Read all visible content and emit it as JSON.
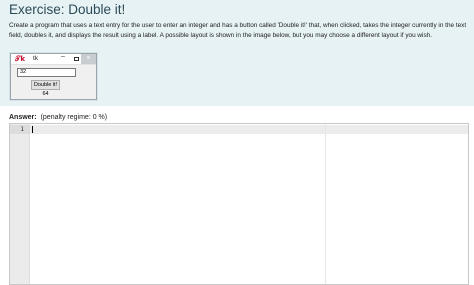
{
  "question": {
    "title": "Exercise: Double it!",
    "description": "Create a program that uses a text entry for the user to enter an integer and has a button called 'Double it!' that, when clicked, takes the integer currently in the text field, doubles it, and displays the result using a label. A possible layout is shown in the image below, but you may choose a different layout if you wish."
  },
  "tk_window": {
    "icon": "tk-feather-icon",
    "title": "tk",
    "minimize_glyph": "–",
    "close_glyph": "×",
    "entry_value": "32",
    "button_label": "Double it!",
    "result_label": "64"
  },
  "answer": {
    "label": "Answer:",
    "penalty": "(penalty regime: 0 %)"
  },
  "editor": {
    "line_numbers": [
      "1"
    ],
    "content": ""
  }
}
